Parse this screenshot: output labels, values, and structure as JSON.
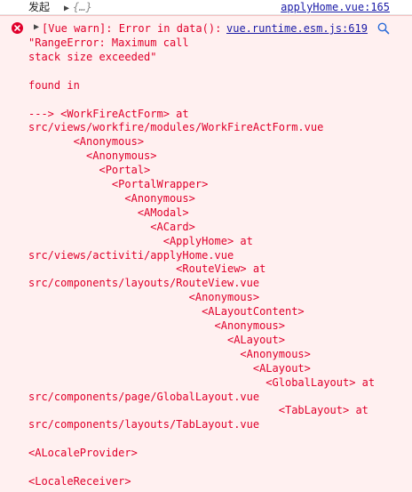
{
  "top_row": {
    "message": "发起",
    "object_preview": "{…}",
    "source_link": "applyHome.vue:165"
  },
  "error": {
    "heading": "[Vue warn]: Error in data():",
    "source_link": "vue.runtime.esm.js:619",
    "lines": [
      "\"RangeError: Maximum call",
      "stack size exceeded\"",
      "",
      "found in",
      "",
      "---> <WorkFireActForm> at",
      "src/views/workfire/modules/WorkFireActForm.vue",
      "       <Anonymous>",
      "         <Anonymous>",
      "           <Portal>",
      "             <PortalWrapper>",
      "               <Anonymous>",
      "                 <AModal>",
      "                   <ACard>",
      "                     <ApplyHome> at",
      "src/views/activiti/applyHome.vue",
      "                       <RouteView> at",
      "src/components/layouts/RouteView.vue",
      "                         <Anonymous>",
      "                           <ALayoutContent>",
      "                             <Anonymous>",
      "                               <ALayout>",
      "                                 <Anonymous>",
      "                                   <ALayout>",
      "                                     <GlobalLayout> at",
      "src/components/page/GlobalLayout.vue",
      "                                       <TabLayout> at",
      "src/components/layouts/TabLayout.vue",
      "",
      "<ALocaleProvider>",
      "",
      "<LocaleReceiver>"
    ]
  },
  "colors": {
    "error_text": "#e0002b",
    "error_bg": "#fff0f0",
    "link": "#1a1aa6"
  },
  "icons": [
    "expand-triangle-icon",
    "error-circle-icon",
    "search-icon"
  ]
}
